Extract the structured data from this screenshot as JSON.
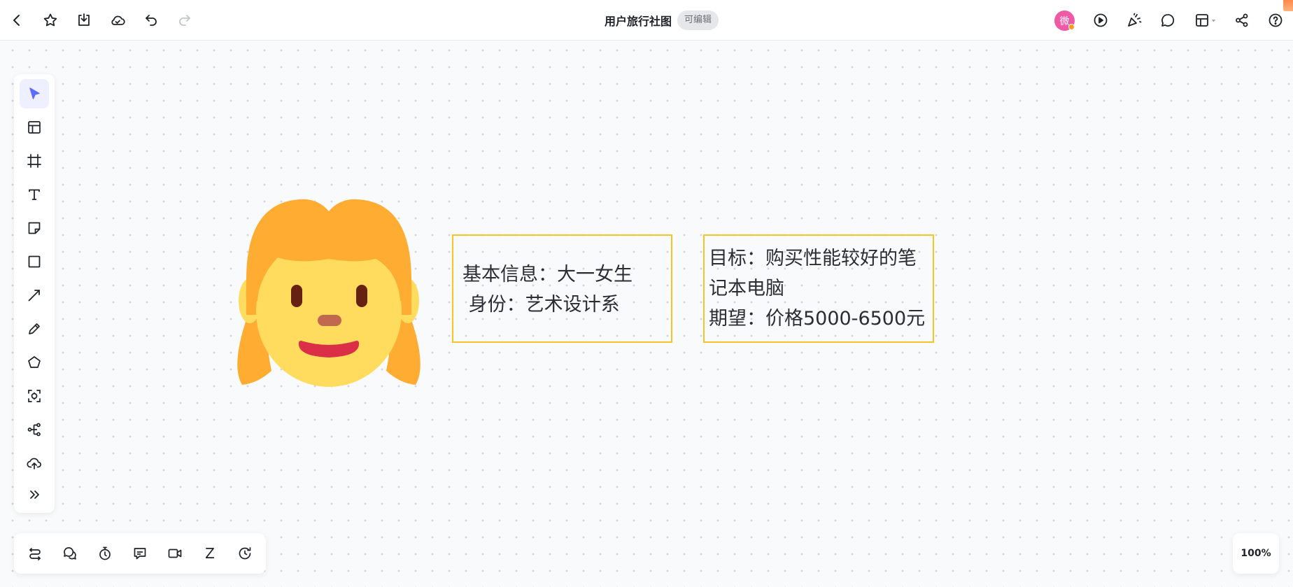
{
  "document": {
    "title": "用户旅行社图",
    "edit_badge": "可编辑"
  },
  "header": {
    "left_icons": [
      "back-icon",
      "star-icon",
      "download-icon",
      "cloud-icon",
      "undo-icon",
      "redo-icon"
    ],
    "right_icons": [
      "play-icon",
      "celebrate-icon",
      "comment-icon",
      "layout-icon",
      "share-icon",
      "help-icon"
    ],
    "avatar_initial": "微"
  },
  "left_toolbar": {
    "tools": [
      "select-tool",
      "template-tool",
      "frame-tool",
      "text-tool",
      "sticky-note-tool",
      "rectangle-tool",
      "line-tool",
      "pen-tool",
      "polygon-tool",
      "ai-tool",
      "mindmap-tool",
      "upload-tool",
      "more-tool"
    ],
    "active_tool": "select-tool"
  },
  "bottom_toolbar": {
    "tools": [
      "flow-tool",
      "chat-tool",
      "timer-tool",
      "comment-tool",
      "video-tool",
      "z-tool",
      "history-tool"
    ],
    "z_label": "Z"
  },
  "canvas": {
    "image": "girl-face-emoji",
    "note1": {
      "line1": "基本信息：大一女生",
      "line2": " 身份：艺术设计系"
    },
    "note2": {
      "line1": "目标：购买性能较好的笔",
      "line2": "记本电脑",
      "line3": "期望：价格5000-6500元"
    }
  },
  "zoom": {
    "level": "100%"
  },
  "colors": {
    "accent": "#5b6bff",
    "note_border": "#f7c325",
    "avatar_bg": "#ef5aa6"
  }
}
